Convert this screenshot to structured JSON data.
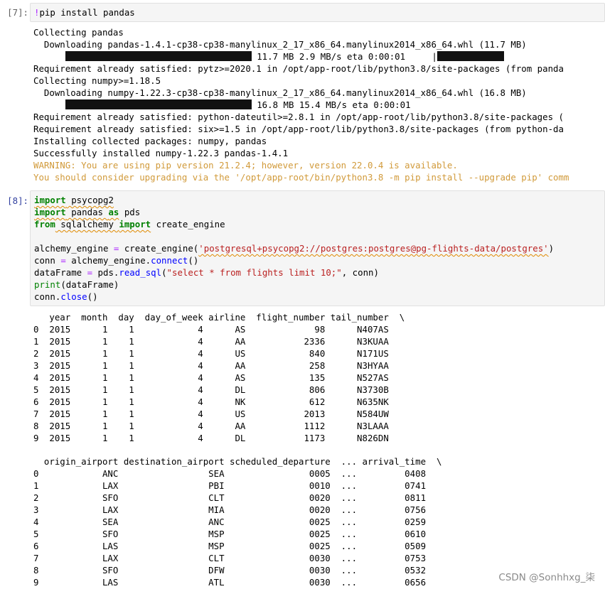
{
  "cells": [
    {
      "prompt": "[7]:",
      "code_cmd": "pip install pandas",
      "code_bang": "!",
      "output": {
        "lines": [
          "Collecting pandas",
          "  Downloading pandas-1.4.1-cp38-cp38-manylinux_2_17_x86_64.manylinux2014_x86_64.whl (11.7 MB)",
          "| 11.7 MB 2.9 MB/s eta 0:00:01     |",
          "Requirement already satisfied: pytz>=2020.1 in /opt/app-root/lib/python3.8/site-packages (from panda",
          "Collecting numpy>=1.18.5",
          "  Downloading numpy-1.22.3-cp38-cp38-manylinux_2_17_x86_64.manylinux2014_x86_64.whl (16.8 MB)",
          "| 16.8 MB 15.4 MB/s eta 0:00:01",
          "Requirement already satisfied: python-dateutil>=2.8.1 in /opt/app-root/lib/python3.8/site-packages (",
          "Requirement already satisfied: six>=1.5 in /opt/app-root/lib/python3.8/site-packages (from python-da",
          "Installing collected packages: numpy, pandas",
          "Successfully installed numpy-1.22.3 pandas-1.4.1"
        ],
        "warnings": [
          "WARNING: You are using pip version 21.2.4; however, version 22.0.4 is available.",
          "You should consider upgrading via the '/opt/app-root/bin/python3.8 -m pip install --upgrade pip' comm"
        ]
      }
    },
    {
      "prompt": "[8]:",
      "code": {
        "l1_kw": "import",
        "l1_rest": " psycopg2",
        "l2_kw": "import",
        "l2_mod": " pandas ",
        "l2_as": "as",
        "l2_alias": " pds",
        "l3_kw": "from",
        "l3_mod": " sqlalchemy ",
        "l3_imp": "import",
        "l3_rest": " create_engine",
        "l5_a": "alchemy_engine ",
        "l5_eq": "=",
        "l5_b": " create_engine(",
        "l5_str": "'postgresql+psycopg2://postgres:postgres@pg-flights-data/postgres'",
        "l5_c": ")",
        "l6_a": "conn ",
        "l6_eq": "=",
        "l6_b": " alchemy_engine.",
        "l6_fn": "connect",
        "l6_c": "()",
        "l7_a": "dataFrame ",
        "l7_eq": "=",
        "l7_b": " pds.",
        "l7_fn": "read_sql",
        "l7_c": "(",
        "l7_str": "\"select * from flights limit 10;\"",
        "l7_d": ", conn)",
        "l8_fn": "print",
        "l8_rest": "(dataFrame)",
        "l9_a": "conn.",
        "l9_fn": "close",
        "l9_b": "()"
      }
    }
  ],
  "table1": {
    "header": "   year  month  day  day_of_week airline  flight_number tail_number  \\",
    "rows": [
      "0  2015      1    1            4      AS             98      N407AS",
      "1  2015      1    1            4      AA           2336      N3KUAA",
      "2  2015      1    1            4      US            840      N171US",
      "3  2015      1    1            4      AA            258      N3HYAA",
      "4  2015      1    1            4      AS            135      N527AS",
      "5  2015      1    1            4      DL            806      N3730B",
      "6  2015      1    1            4      NK            612      N635NK",
      "7  2015      1    1            4      US           2013      N584UW",
      "8  2015      1    1            4      AA           1112      N3LAAA",
      "9  2015      1    1            4      DL           1173      N826DN"
    ]
  },
  "table2": {
    "header": "  origin_airport destination_airport scheduled_departure  ... arrival_time  \\",
    "rows": [
      "0            ANC                 SEA                0005  ...         0408",
      "1            LAX                 PBI                0010  ...         0741",
      "2            SFO                 CLT                0020  ...         0811",
      "3            LAX                 MIA                0020  ...         0756",
      "4            SEA                 ANC                0025  ...         0259",
      "5            SFO                 MSP                0025  ...         0610",
      "6            LAS                 MSP                0025  ...         0509",
      "7            LAX                 CLT                0030  ...         0753",
      "8            SFO                 DFW                0030  ...         0532",
      "9            LAS                 ATL                0030  ...         0656"
    ]
  },
  "watermark": "CSDN @Sonhhxg_柒"
}
